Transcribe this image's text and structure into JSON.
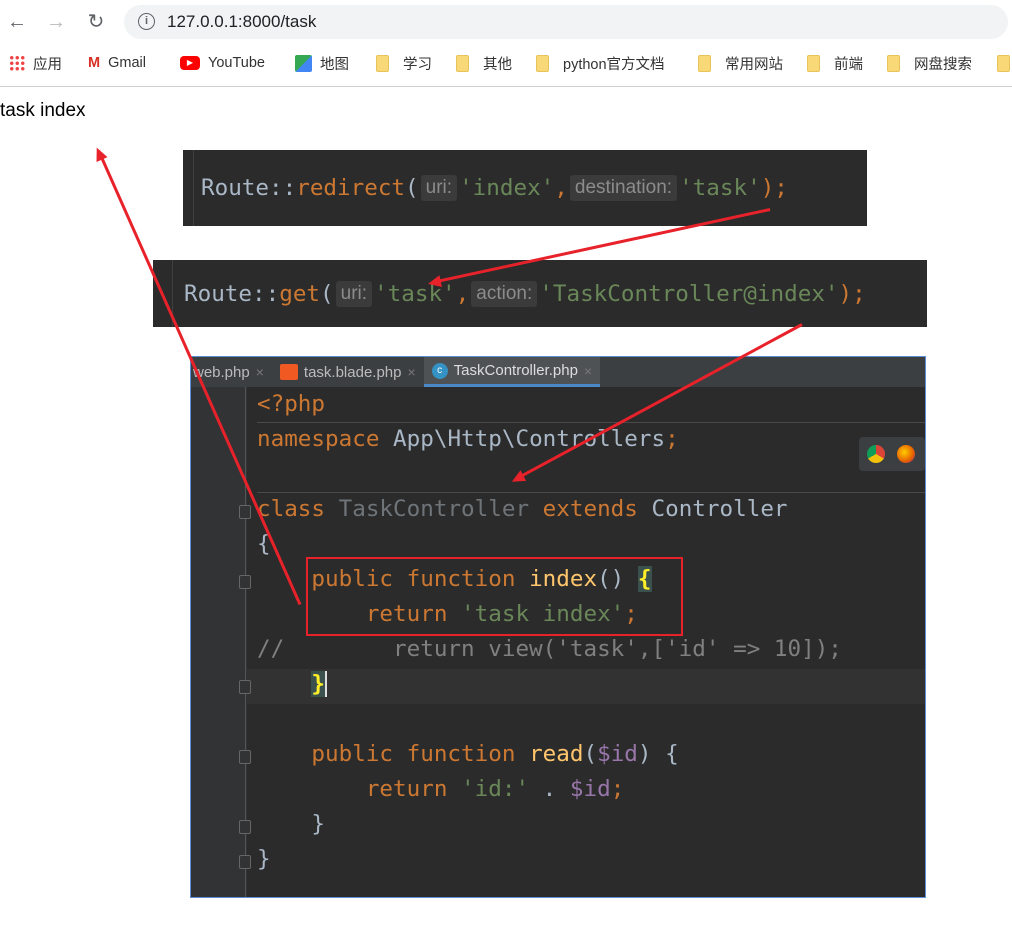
{
  "browser": {
    "url": "127.0.0.1:8000/task",
    "nav": {
      "back": "←",
      "forward": "→",
      "reload": "↻"
    },
    "bookmarks": [
      {
        "label": "应用",
        "icon": "apps-grid-icon"
      },
      {
        "label": "Gmail",
        "icon": "gmail-icon"
      },
      {
        "label": "YouTube",
        "icon": "youtube-icon"
      },
      {
        "label": "地图",
        "icon": "maps-icon"
      },
      {
        "label": "学习",
        "icon": "folder-icon"
      },
      {
        "label": "其他",
        "icon": "folder-icon"
      },
      {
        "label": "python官方文档",
        "icon": "folder-icon"
      },
      {
        "label": "常用网站",
        "icon": "folder-icon"
      },
      {
        "label": "前端",
        "icon": "folder-icon"
      },
      {
        "label": "网盘搜索",
        "icon": "folder-icon"
      }
    ]
  },
  "page": {
    "text": "task index"
  },
  "route1": {
    "prefix": "Route::",
    "method": "redirect",
    "open": "(",
    "hint1": "uri:",
    "arg1": "'index'",
    "comma": ",",
    "hint2": "destination:",
    "arg2": "'task'",
    "close": ");"
  },
  "route2": {
    "prefix": "Route::",
    "method": "get",
    "open": "(",
    "hint1": "uri:",
    "arg1": "'task'",
    "comma": ",",
    "hint2": "action:",
    "arg2": "'TaskController@index'",
    "close": ");"
  },
  "editor": {
    "tabs": [
      {
        "label": "web.php",
        "active": false
      },
      {
        "label": "task.blade.php",
        "active": false
      },
      {
        "label": "TaskController.php",
        "active": true
      }
    ],
    "close_glyph": "×",
    "code": {
      "l1": "<?php",
      "l2a": "namespace",
      "l2b": " App\\Http\\Controllers",
      "l2c": ";",
      "l4a": "class",
      "l4b": " TaskController ",
      "l4c": "extends",
      "l4d": " Controller",
      "l5": "{",
      "l6a": "    public function ",
      "l6b": "index",
      "l6c": "() ",
      "l6d": "{",
      "l7a": "        return ",
      "l7b": "'task index'",
      "l7c": ";",
      "l8": "//        return view('task',['id' => 10]);",
      "l9a": "    ",
      "l9b": "}",
      "l11a": "    public function ",
      "l11b": "read",
      "l11c": "(",
      "l11d": "$id",
      "l11e": ") {",
      "l12a": "        return ",
      "l12b": "'id:'",
      "l12c": " . ",
      "l12d": "$id",
      "l12e": ";",
      "l13": "    }",
      "l14": "}"
    }
  },
  "colors": {
    "annotation": "#e8222a",
    "keyword": "#cc7832",
    "string": "#6a8759",
    "function": "#ffc66d",
    "variable": "#9876aa"
  }
}
